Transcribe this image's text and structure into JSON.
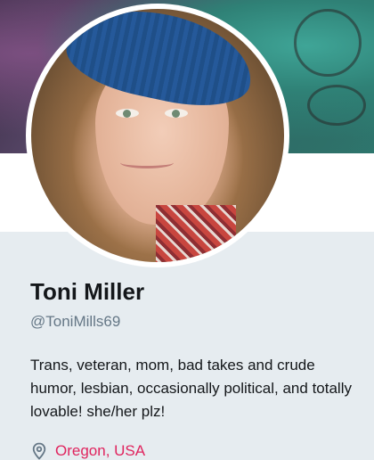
{
  "profile": {
    "name": "Toni Miller",
    "handle": "@ToniMills69",
    "bio": "Trans, veteran, mom, bad takes and crude humor, lesbian, occasionally political, and totally lovable! she/her plz!",
    "location": "Oregon, USA"
  },
  "colors": {
    "name": "#14171a",
    "handle": "#657786",
    "location_link": "#e0245e",
    "page_background": "#e6ecf0"
  },
  "icons": {
    "location": "location-pin-icon"
  }
}
